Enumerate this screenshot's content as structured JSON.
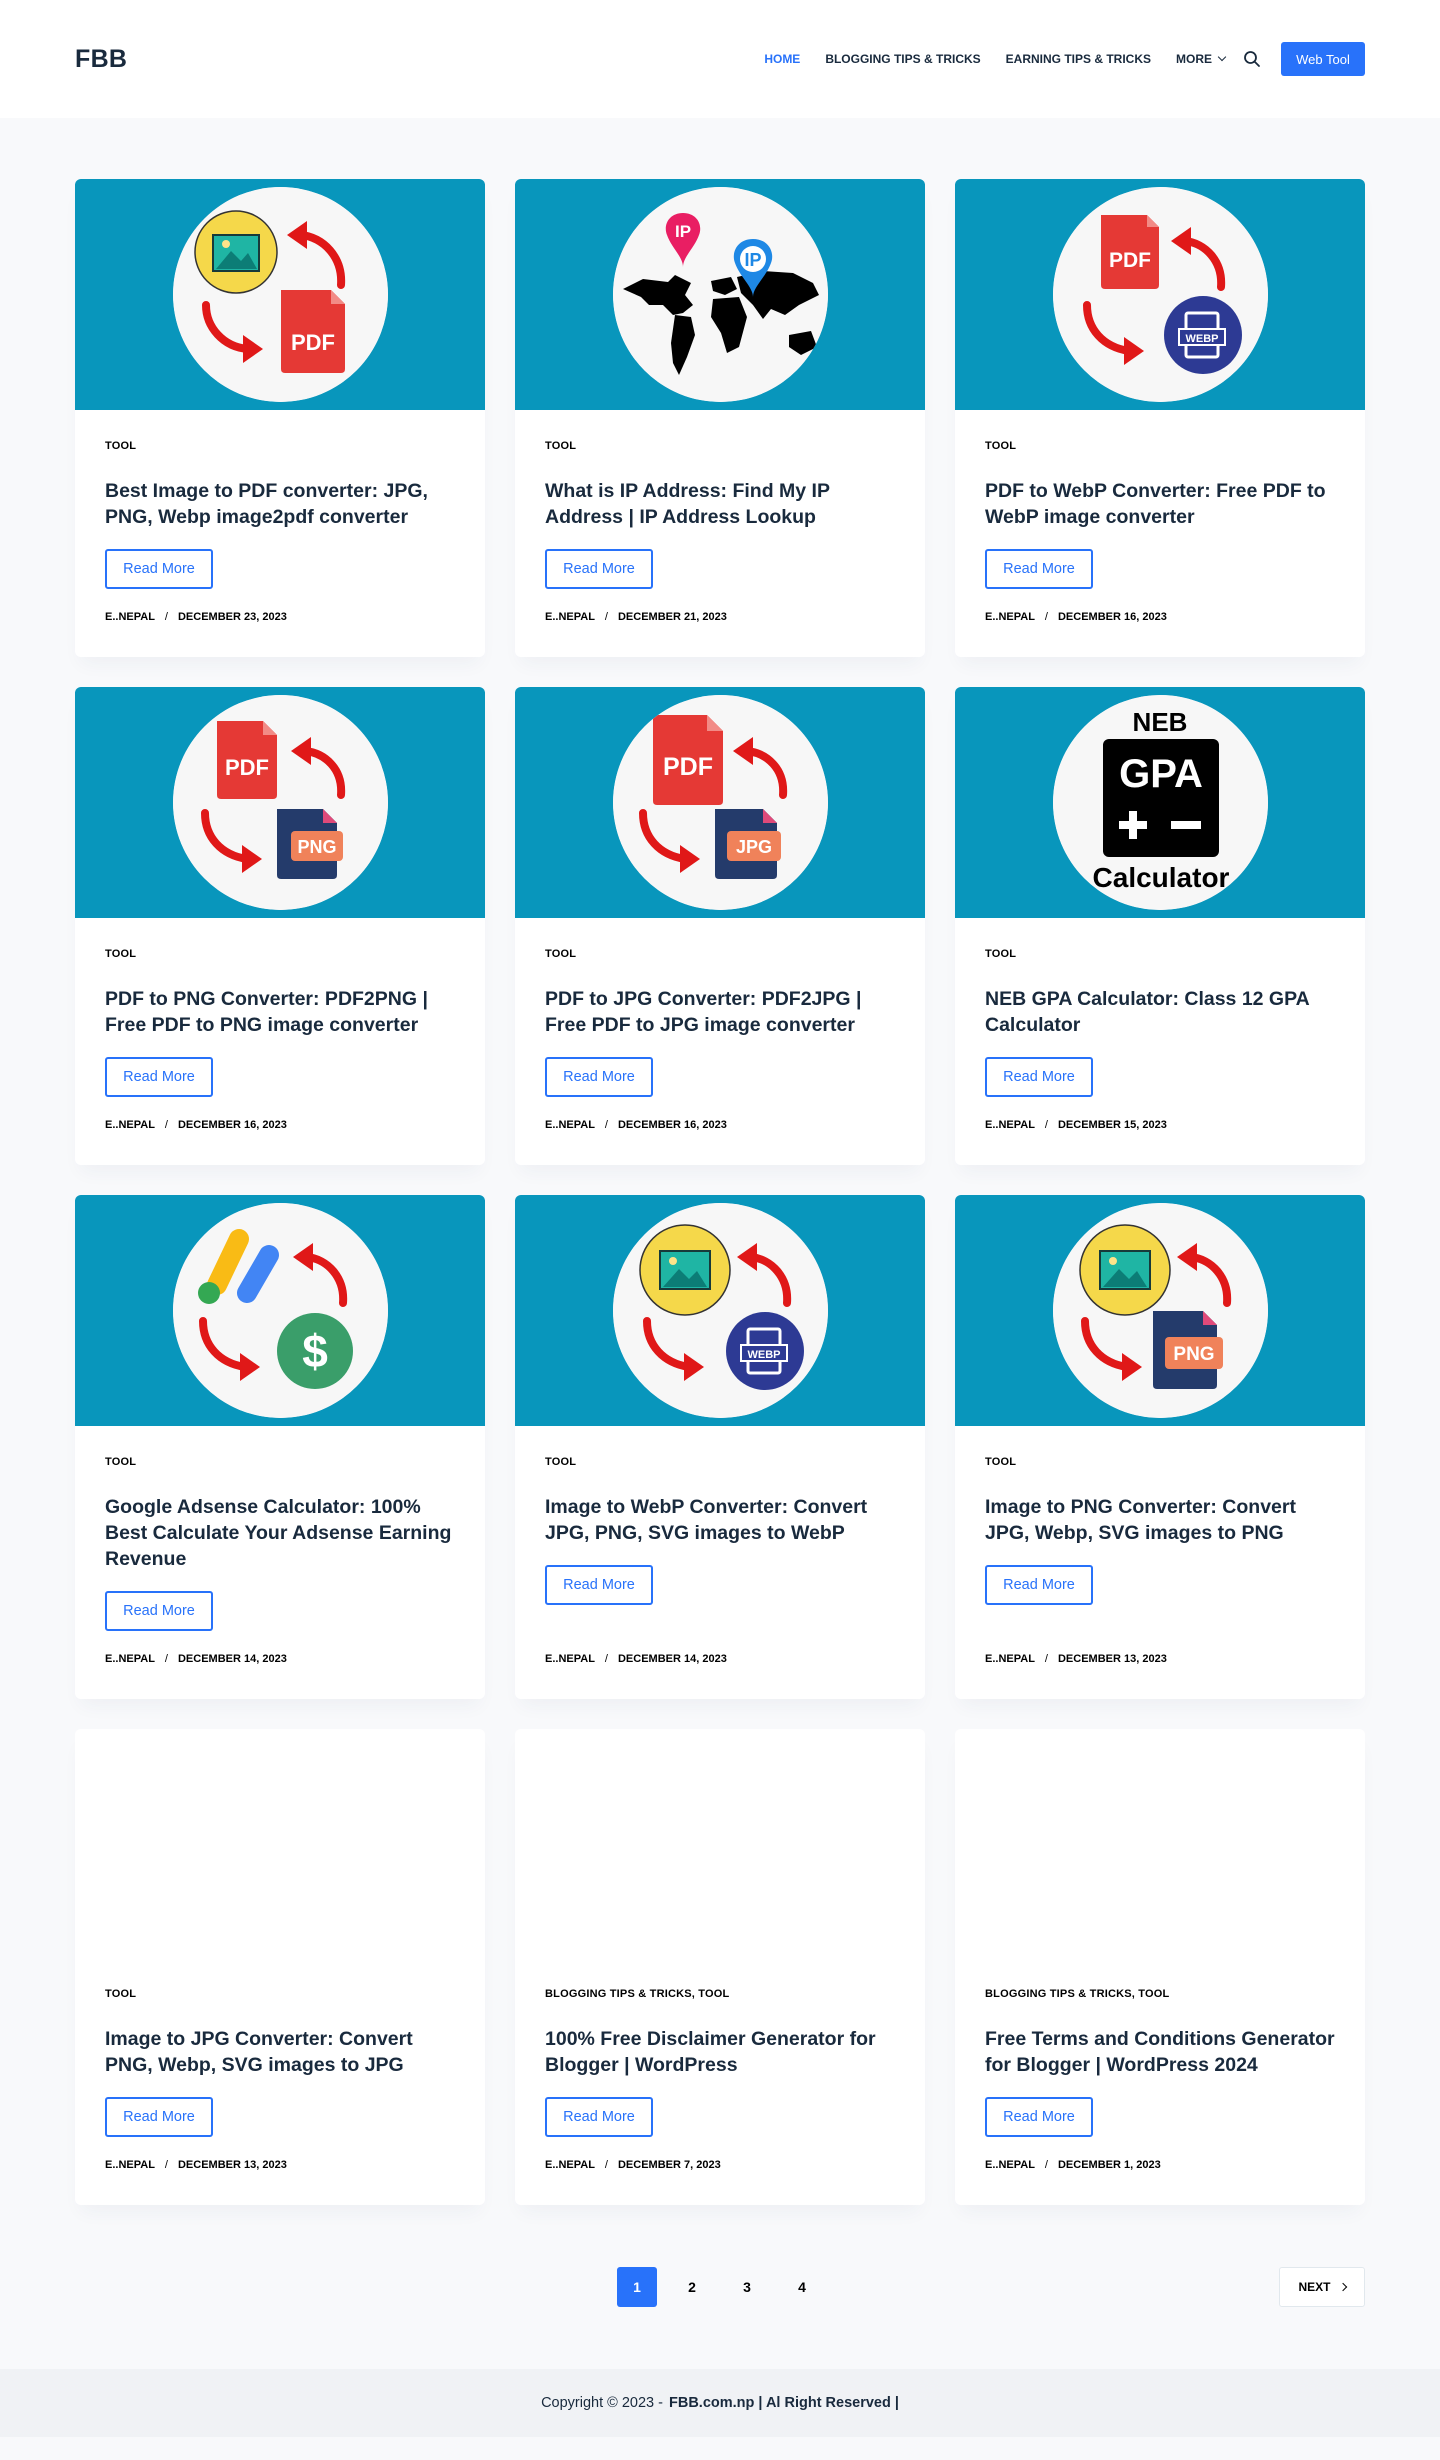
{
  "header": {
    "logo": "FBB",
    "nav": [
      {
        "label": "HOME",
        "active": true
      },
      {
        "label": "BLOGGING TIPS & TRICKS",
        "active": false
      },
      {
        "label": "EARNING TIPS & TRICKS",
        "active": false
      },
      {
        "label": "MORE",
        "active": false
      }
    ],
    "cta": "Web Tool"
  },
  "posts": [
    {
      "category": "TOOL",
      "title": "Best Image to PDF converter: JPG, PNG, Webp image2pdf converter",
      "read_more": "Read More",
      "author": "E..NEPAL",
      "date": "DECEMBER 23, 2023"
    },
    {
      "category": "TOOL",
      "title": "What is IP Address: Find My IP Address | IP Address Lookup",
      "read_more": "Read More",
      "author": "E..NEPAL",
      "date": "DECEMBER 21, 2023"
    },
    {
      "category": "TOOL",
      "title": "PDF to WebP Converter: Free PDF to WebP image converter",
      "read_more": "Read More",
      "author": "E..NEPAL",
      "date": "DECEMBER 16, 2023",
      "thumb_text": [
        "PDF",
        "WEBP"
      ]
    },
    {
      "category": "TOOL",
      "title": "PDF to PNG Converter: PDF2PNG | Free PDF to PNG image converter",
      "read_more": "Read More",
      "author": "E..NEPAL",
      "date": "DECEMBER 16, 2023",
      "thumb_text": [
        "PDF",
        "PNG"
      ]
    },
    {
      "category": "TOOL",
      "title": "PDF to JPG Converter: PDF2JPG | Free PDF to JPG image converter",
      "read_more": "Read More",
      "author": "E..NEPAL",
      "date": "DECEMBER 16, 2023",
      "thumb_text": [
        "PDF",
        "JPG"
      ]
    },
    {
      "category": "TOOL",
      "title": "NEB GPA Calculator: Class 12 GPA Calculator",
      "read_more": "Read More",
      "author": "E..NEPAL",
      "date": "DECEMBER 15, 2023",
      "thumb_text": [
        "NEB",
        "GPA",
        "Calculator"
      ]
    },
    {
      "category": "TOOL",
      "title": "Google Adsense Calculator: 100% Best Calculate Your Adsense Earning Revenue",
      "read_more": "Read More",
      "author": "E..NEPAL",
      "date": "DECEMBER 14, 2023"
    },
    {
      "category": "TOOL",
      "title": "Image to WebP Converter: Convert JPG, PNG, SVG images to WebP",
      "read_more": "Read More",
      "author": "E..NEPAL",
      "date": "DECEMBER 14, 2023",
      "thumb_text": [
        "WEBP"
      ]
    },
    {
      "category": "TOOL",
      "title": "Image to PNG Converter: Convert JPG, Webp, SVG images to PNG",
      "read_more": "Read More",
      "author": "E..NEPAL",
      "date": "DECEMBER 13, 2023",
      "thumb_text": [
        "PNG"
      ]
    },
    {
      "category": "TOOL",
      "title": "Image to JPG Converter: Convert PNG, Webp, SVG images to JPG",
      "read_more": "Read More",
      "author": "E..NEPAL",
      "date": "DECEMBER 13, 2023"
    },
    {
      "category": "BLOGGING TIPS & TRICKS, TOOL",
      "title": "100% Free Disclaimer Generator for Blogger | WordPress",
      "read_more": "Read More",
      "author": "E..NEPAL",
      "date": "DECEMBER 7, 2023"
    },
    {
      "category": "BLOGGING TIPS & TRICKS, TOOL",
      "title": "Free Terms and Conditions Generator for Blogger | WordPress 2024",
      "read_more": "Read More",
      "author": "E..NEPAL",
      "date": "DECEMBER 1, 2023"
    }
  ],
  "thumb_pdf_label": "PDF",
  "thumb_ip_label": "IP",
  "pagination": {
    "pages": [
      "1",
      "2",
      "3",
      "4"
    ],
    "current": "1",
    "next": "NEXT"
  },
  "footer": {
    "copyright": "Copyright © 2023 -",
    "site": "FBB.com.np | Al Right Reserved |"
  },
  "colors": {
    "accent": "#2872fa",
    "thumb_bg": "#0896bc",
    "page_bg": "#f8f9fb",
    "arrow_red": "#e01818",
    "pdf_red": "#e53935"
  },
  "icons": [
    "search-icon",
    "chevron-down-icon",
    "chevron-right-icon"
  ]
}
